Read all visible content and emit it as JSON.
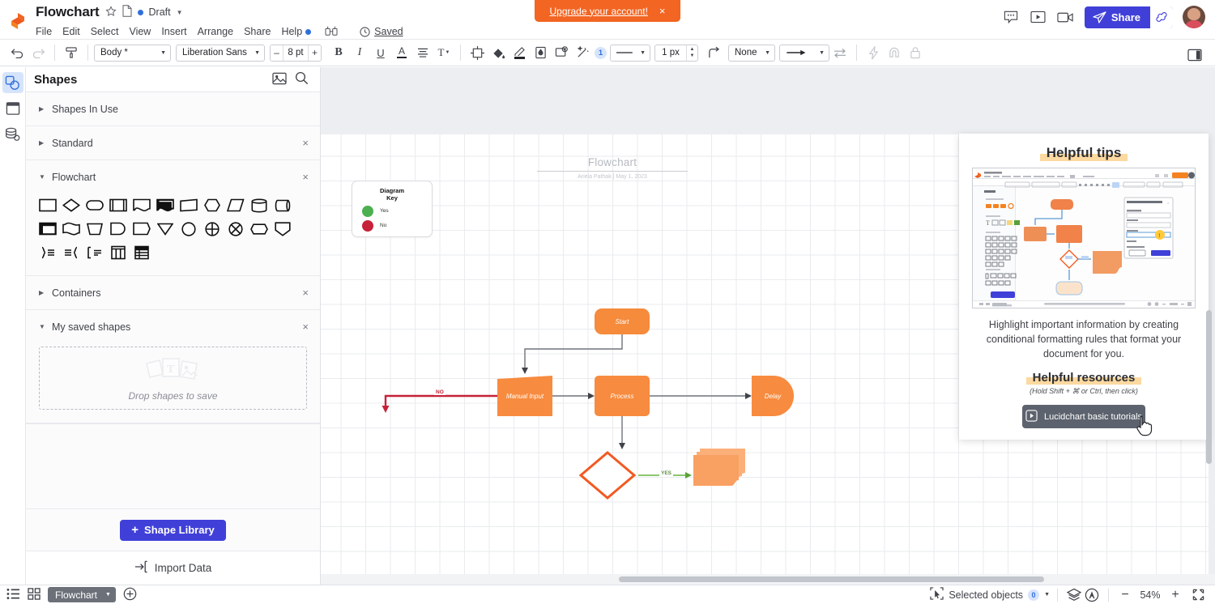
{
  "app": {
    "doc_title": "Flowchart",
    "status_label": "Draft",
    "saved_label": "Saved",
    "menu": [
      "File",
      "Edit",
      "Select",
      "View",
      "Insert",
      "Arrange",
      "Share",
      "Help"
    ],
    "upgrade": {
      "text": "Upgrade your account!",
      "close": "×"
    },
    "share_label": "Share",
    "accent": "#4040d9",
    "brand_orange": "#f26522"
  },
  "toolbar": {
    "style_select": "Body *",
    "font_select": "Liberation Sans",
    "font_size": "8 pt",
    "minus": "–",
    "plus": "+",
    "bold": "B",
    "italic": "I",
    "underline": "U",
    "text_color": "A",
    "align": "align-icon",
    "text_options": "T",
    "theme_count": "1",
    "line_width": "1 px",
    "line_start": "None",
    "line_end": "arrow",
    "icons": [
      "crosshair-icon",
      "fill-icon",
      "line-color-icon",
      "opacity-icon",
      "image-icon",
      "magic-icon"
    ]
  },
  "rail": {
    "items": [
      {
        "name": "shapes-icon",
        "active": true
      },
      {
        "name": "templates-icon",
        "active": false
      },
      {
        "name": "data-icon",
        "active": false
      }
    ]
  },
  "panel": {
    "title": "Shapes",
    "head_icons": [
      "image-search-icon",
      "search-icon"
    ],
    "sections": [
      {
        "label": "Shapes In Use",
        "expanded": false,
        "closable": false
      },
      {
        "label": "Standard",
        "expanded": false,
        "closable": true
      },
      {
        "label": "Flowchart",
        "expanded": true,
        "closable": true
      },
      {
        "label": "Containers",
        "expanded": false,
        "closable": true
      },
      {
        "label": "My saved shapes",
        "expanded": true,
        "closable": true
      }
    ],
    "dropzone_text": "Drop shapes to save",
    "shape_library_label": "Shape Library",
    "import_data_label": "Import Data",
    "flowchart_shapes": [
      "process",
      "decision",
      "terminator",
      "predefined-process",
      "document",
      "multi-document",
      "data",
      "preparation",
      "manual-operation",
      "database",
      "direct-data",
      "internal-storage",
      "paper-tape",
      "manual-input",
      "delay",
      "stored-data",
      "merge",
      "or",
      "summing-junction",
      "display",
      "extract",
      "off-page-connector",
      "annotation-right",
      "annotation-left",
      "loop-limit",
      "parallel-mode",
      "table"
    ]
  },
  "canvas": {
    "page_heading": "Flowchart",
    "page_subheading": "Ariela Pathak  |  May 1, 2023",
    "legend": {
      "title_line1": "Diagram",
      "title_line2": "Key",
      "entries": [
        {
          "label": "Yes",
          "color": "#4caf50"
        },
        {
          "label": "No",
          "color": "#c62239"
        }
      ]
    },
    "nodes": [
      {
        "id": "start",
        "label": "Start",
        "color": "#f68b3c"
      },
      {
        "id": "manual-input",
        "label": "Manual Input",
        "color": "#f78b3f"
      },
      {
        "id": "process",
        "label": "Process",
        "color": "#f78b3f"
      },
      {
        "id": "delay",
        "label": "Delay",
        "color": "#f78b3f"
      },
      {
        "id": "decision",
        "label": "",
        "color": "#ffffff"
      },
      {
        "id": "document",
        "label": "",
        "color": "#f9a063"
      },
      {
        "id": "blank-terminator",
        "label": "",
        "color": "#fbd9a8"
      }
    ],
    "edge_labels": [
      {
        "id": "no-edge",
        "label": "NO",
        "color": "#c62239"
      },
      {
        "id": "yes-edge",
        "label": "YES",
        "color": "#7bbf5a"
      }
    ]
  },
  "tip_panel": {
    "heading": "Helpful tips",
    "body": "Highlight important information by creating conditional formatting rules that format your document for you.",
    "resources_heading": "Helpful resources",
    "resources_note": "(Hold Shift + ⌘ or Ctrl, then click)",
    "tutorial_button": "Lucidchart basic tutorials"
  },
  "statusbar": {
    "page_tab": "Flowchart",
    "selected_objects_label": "Selected objects",
    "selected_count": "0",
    "zoom_level": "54%",
    "icons": [
      "list-view-icon",
      "grid-view-icon",
      "add-page-icon",
      "selection-icon",
      "layers-icon",
      "accessibility-icon",
      "zoom-out-icon",
      "zoom-in-icon",
      "fullscreen-icon"
    ]
  }
}
